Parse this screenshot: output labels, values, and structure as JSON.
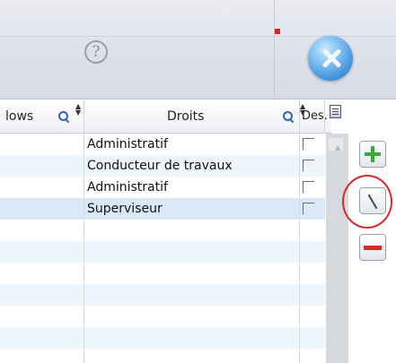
{
  "toolbar": {
    "help_icon": "question-circle-icon",
    "help_glyph": "?",
    "close_icon": "close-icon"
  },
  "table": {
    "columns": [
      {
        "label": "lows"
      },
      {
        "label": "Droits"
      },
      {
        "label": "Des."
      }
    ],
    "rows": [
      {
        "droits": "Administratif",
        "des_checked": false
      },
      {
        "droits": "Conducteur de travaux",
        "des_checked": false
      },
      {
        "droits": "Administratif",
        "des_checked": false
      },
      {
        "droits": "Superviseur",
        "des_checked": false,
        "selected": true
      }
    ]
  },
  "side_buttons": {
    "add_icon": "plus-icon",
    "edit_icon": "pencil-icon",
    "remove_icon": "minus-icon"
  },
  "colors": {
    "add": "#3aa83a",
    "remove": "#d62a2a",
    "annotation_ring": "#d42a2a",
    "selected_row": "#d9e9f7",
    "alt_row": "#eef5fb"
  }
}
